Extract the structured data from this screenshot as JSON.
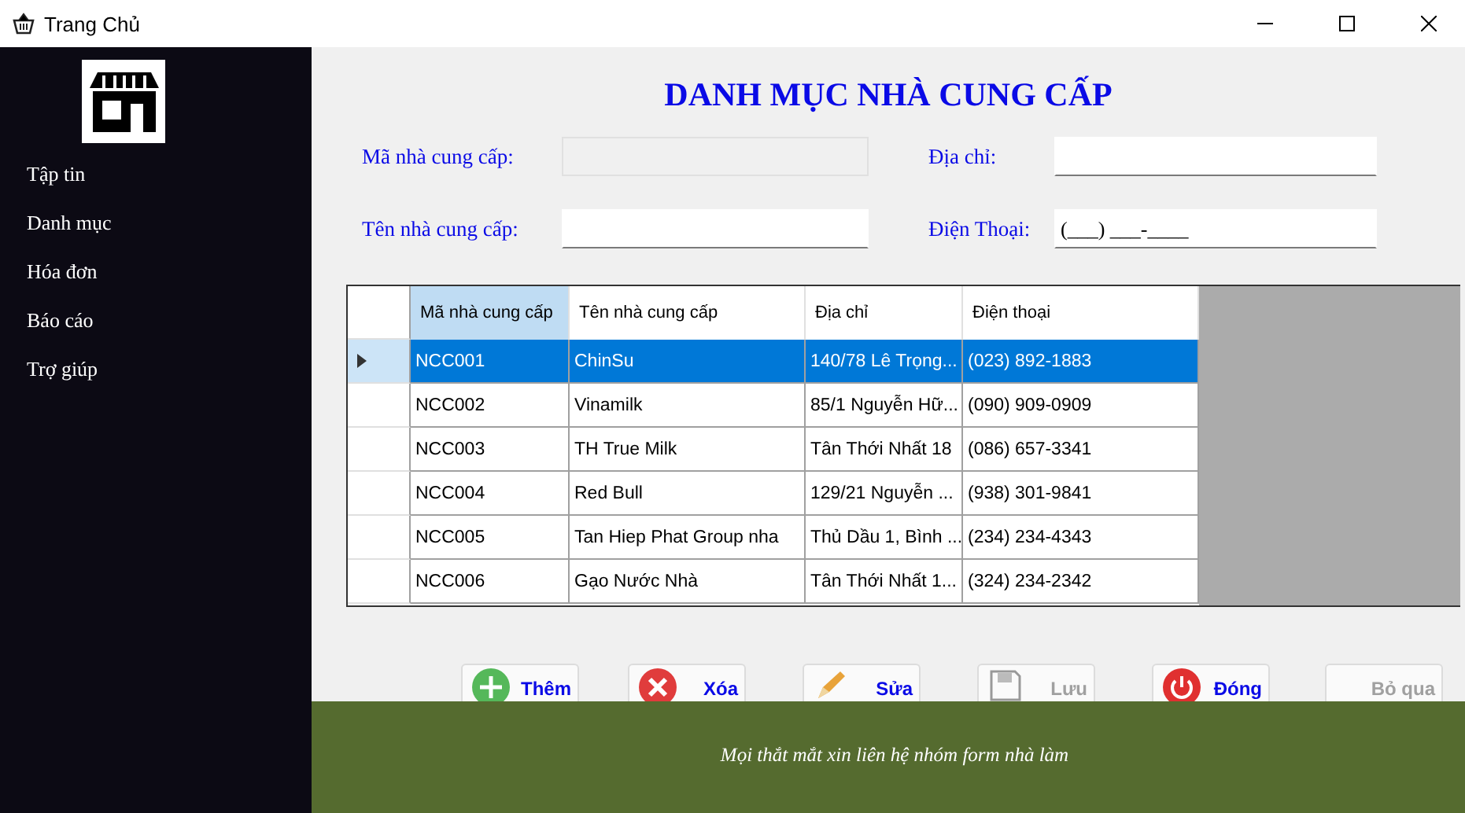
{
  "window": {
    "title": "Trang Chủ"
  },
  "sidebar": {
    "items": [
      {
        "label": "Tập tin"
      },
      {
        "label": "Danh mục"
      },
      {
        "label": "Hóa đơn"
      },
      {
        "label": "Báo cáo"
      },
      {
        "label": "Trợ giúp"
      }
    ]
  },
  "heading": "DANH MỤC NHÀ CUNG CẤP",
  "form": {
    "fields": [
      {
        "label": "Mã nhà cung cấp:",
        "disabled": true
      },
      {
        "label": "Địa chỉ:",
        "disabled": false
      },
      {
        "label": "Tên nhà cung cấp:",
        "disabled": false
      },
      {
        "label": "Điện Thoại:",
        "disabled": false,
        "value": "(___) ___-____"
      }
    ]
  },
  "table": {
    "columns": [
      "Mã nhà cung cấp",
      "Tên nhà cung cấp",
      "Địa chỉ",
      "Điện thoại"
    ],
    "rows": [
      {
        "cells": [
          "NCC001",
          "ChinSu",
          "140/78 Lê Trọng...",
          "(023) 892-1883"
        ],
        "selected": true
      },
      {
        "cells": [
          "NCC002",
          "Vinamilk",
          "85/1 Nguyễn Hữ...",
          "(090) 909-0909"
        ],
        "selected": false
      },
      {
        "cells": [
          "NCC003",
          "TH True Milk",
          "Tân Thới Nhất 18",
          "(086) 657-3341"
        ],
        "selected": false
      },
      {
        "cells": [
          "NCC004",
          "Red Bull",
          "129/21 Nguyễn ...",
          "(938) 301-9841"
        ],
        "selected": false
      },
      {
        "cells": [
          "NCC005",
          "Tan Hiep Phat Group nha",
          "Thủ Dầu 1, Bình ...",
          "(234) 234-4343"
        ],
        "selected": false
      },
      {
        "cells": [
          "NCC006",
          "Gạo  Nước Nhà",
          "Tân Thới Nhất 1...",
          "(324) 234-2342"
        ],
        "selected": false
      }
    ]
  },
  "buttons": [
    {
      "label": "Thêm",
      "kind": "add",
      "disabled": false
    },
    {
      "label": "Xóa",
      "kind": "delete",
      "disabled": false
    },
    {
      "label": "Sửa",
      "kind": "edit",
      "disabled": false
    },
    {
      "label": "Lưu",
      "kind": "save",
      "disabled": true
    },
    {
      "label": "Đóng",
      "kind": "close",
      "disabled": false
    },
    {
      "label": "Bỏ qua",
      "kind": "skip",
      "disabled": true
    }
  ],
  "footer": "Mọi thắt mắt xin liên hệ nhóm form nhà làm"
}
